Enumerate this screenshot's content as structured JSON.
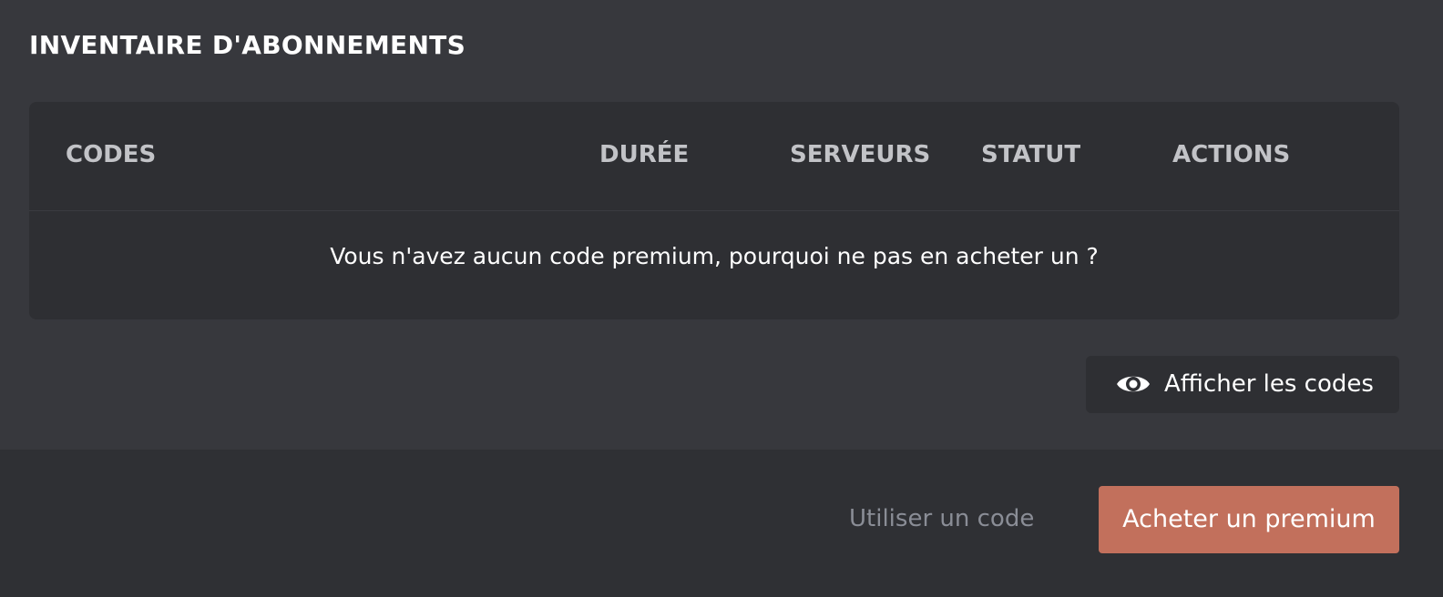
{
  "section": {
    "title": "INVENTAIRE D'ABONNEMENTS"
  },
  "table": {
    "columns": [
      "CODES",
      "DURÉE",
      "SERVEURS",
      "STATUT",
      "ACTIONS"
    ],
    "rows": [],
    "empty_message": "Vous n'avez aucun code premium, pourquoi ne pas en acheter un ?"
  },
  "show_codes": {
    "icon": "eye-icon",
    "label": "Afficher les codes"
  },
  "footer": {
    "use_code_label": "Utiliser un code",
    "buy_label": "Acheter un premium"
  },
  "colors": {
    "accent": "#c2705c",
    "background": "#37383d",
    "card": "#2e2f33",
    "footer": "#2f3034",
    "muted_text": "#8a8d96"
  }
}
